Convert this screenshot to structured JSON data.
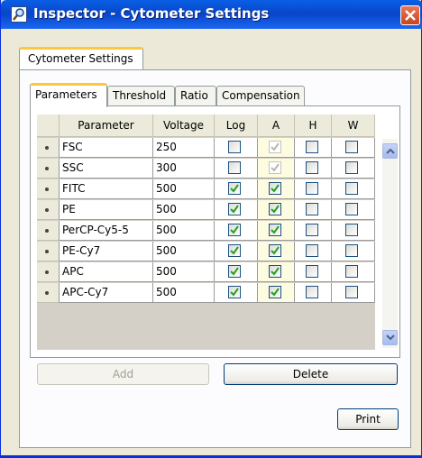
{
  "window": {
    "title": "Inspector - Cytometer Settings",
    "icon": "inspector-magnifier-icon",
    "close_icon": "close-icon"
  },
  "outer_tab": {
    "label": "Cytometer Settings"
  },
  "inner_tabs": [
    {
      "label": "Parameters",
      "active": true
    },
    {
      "label": "Threshold",
      "active": false
    },
    {
      "label": "Ratio",
      "active": false
    },
    {
      "label": "Compensation",
      "active": false
    }
  ],
  "table": {
    "headers": {
      "parameter": "Parameter",
      "voltage": "Voltage",
      "log": "Log",
      "a": "A",
      "h": "H",
      "w": "W"
    },
    "rows": [
      {
        "parameter": "FSC",
        "voltage": "250",
        "log": false,
        "a": true,
        "a_disabled": true,
        "h": false,
        "w": false
      },
      {
        "parameter": "SSC",
        "voltage": "300",
        "log": false,
        "a": true,
        "a_disabled": true,
        "h": false,
        "w": false
      },
      {
        "parameter": "FITC",
        "voltage": "500",
        "log": true,
        "a": true,
        "a_disabled": false,
        "h": false,
        "w": false
      },
      {
        "parameter": "PE",
        "voltage": "500",
        "log": true,
        "a": true,
        "a_disabled": false,
        "h": false,
        "w": false
      },
      {
        "parameter": "PerCP-Cy5-5",
        "voltage": "500",
        "log": true,
        "a": true,
        "a_disabled": false,
        "h": false,
        "w": false
      },
      {
        "parameter": "PE-Cy7",
        "voltage": "500",
        "log": true,
        "a": true,
        "a_disabled": false,
        "h": false,
        "w": false
      },
      {
        "parameter": "APC",
        "voltage": "500",
        "log": true,
        "a": true,
        "a_disabled": false,
        "h": false,
        "w": false
      },
      {
        "parameter": "APC-Cy7",
        "voltage": "500",
        "log": true,
        "a": true,
        "a_disabled": false,
        "h": false,
        "w": false
      }
    ]
  },
  "buttons": {
    "add": "Add",
    "delete": "Delete",
    "print": "Print"
  },
  "colors": {
    "title_bar": "#0a5fe6",
    "tab_highlight": "#ffc83c",
    "check_green": "#21a121",
    "a_column_bg": "#fdfbe0"
  }
}
